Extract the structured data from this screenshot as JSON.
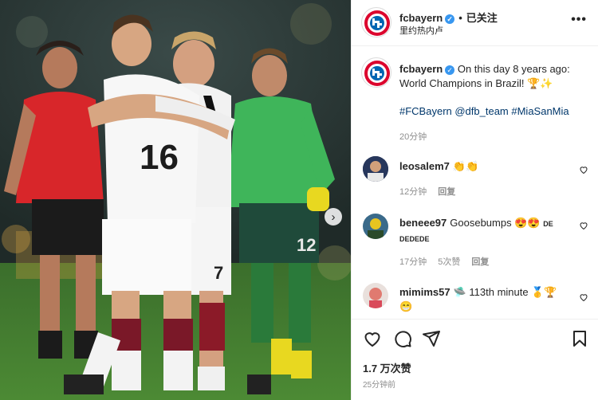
{
  "post": {
    "username": "fcbayern",
    "verified_icon": "✓",
    "separator": "•",
    "follow_label": "已关注",
    "location": "里约热内卢",
    "more_icon": "•••",
    "caption_text": "On this day 8 years ago: World Champions in Brazil! 🏆✨",
    "hashtags": "#FCBayern @dfb_team #MiaSanMia",
    "caption_time": "20分钟",
    "photo_jersey_number": "16",
    "photo_jersey_number_2": "7",
    "photo_jersey_number_3": "12",
    "next_icon": "›"
  },
  "comments": [
    {
      "username": "leosalem7",
      "text": "👏👏",
      "time": "12分钟",
      "likes": "",
      "reply": "回复"
    },
    {
      "username": "beneee97",
      "text": "Goosebumps 😍😍",
      "suffix_small": "DE DEDEDE",
      "time": "17分钟",
      "likes": "5次赞",
      "reply": "回复"
    },
    {
      "username": "mimims57",
      "text": "🛸 113th minute 🥇🏆",
      "line2": "😁",
      "time": "",
      "likes": "",
      "reply": ""
    }
  ],
  "actions": {
    "like_icon": "heart-icon",
    "comment_icon": "comment-icon",
    "share_icon": "send-icon",
    "save_icon": "bookmark-icon"
  },
  "stats": {
    "likes": "1.7 万次赞",
    "posted": "25分钟前"
  },
  "colors": {
    "brand_red": "#dc052d",
    "brand_blue": "#0066b2",
    "link": "#00376b",
    "verified": "#3897f0"
  }
}
